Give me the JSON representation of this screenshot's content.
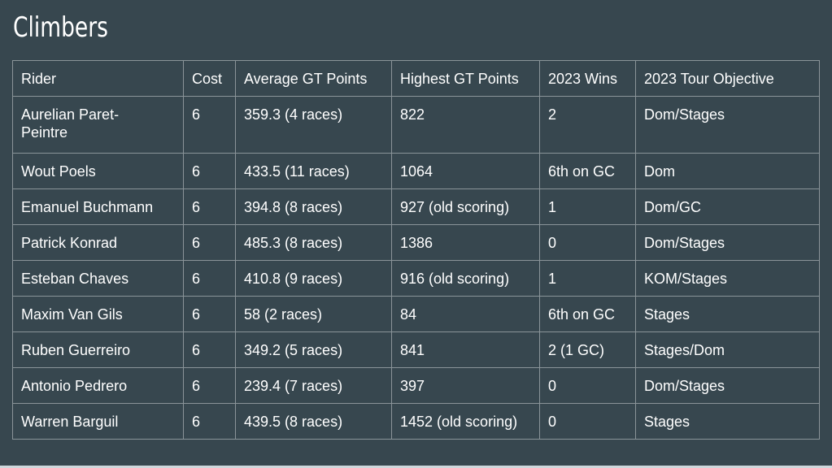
{
  "title": "Climbers",
  "table": {
    "columns": [
      "Rider",
      "Cost",
      "Average GT Points",
      "Highest GT Points",
      "2023 Wins",
      "2023 Tour Objective"
    ],
    "rows": [
      [
        "Aurelian Paret-Peintre",
        "6",
        "359.3 (4 races)",
        "822",
        "2",
        "Dom/Stages"
      ],
      [
        "Wout Poels",
        "6",
        "433.5 (11 races)",
        "1064",
        "6th on GC",
        "Dom"
      ],
      [
        "Emanuel Buchmann",
        "6",
        "394.8 (8 races)",
        "927 (old scoring)",
        "1",
        "Dom/GC"
      ],
      [
        "Patrick Konrad",
        "6",
        "485.3 (8 races)",
        "1386",
        "0",
        "Dom/Stages"
      ],
      [
        "Esteban Chaves",
        "6",
        "410.8 (9 races)",
        "916 (old scoring)",
        "1",
        "KOM/Stages"
      ],
      [
        "Maxim Van Gils",
        "6",
        "58 (2 races)",
        "84",
        "6th on GC",
        "Stages"
      ],
      [
        "Ruben Guerreiro",
        "6",
        "349.2 (5 races)",
        "841",
        "2 (1 GC)",
        "Stages/Dom"
      ],
      [
        "Antonio Pedrero",
        "6",
        "239.4 (7 races)",
        "397",
        "0",
        "Dom/Stages"
      ],
      [
        "Warren Barguil",
        "6",
        "439.5 (8 races)",
        "1452 (old scoring)",
        "0",
        "Stages"
      ]
    ]
  }
}
